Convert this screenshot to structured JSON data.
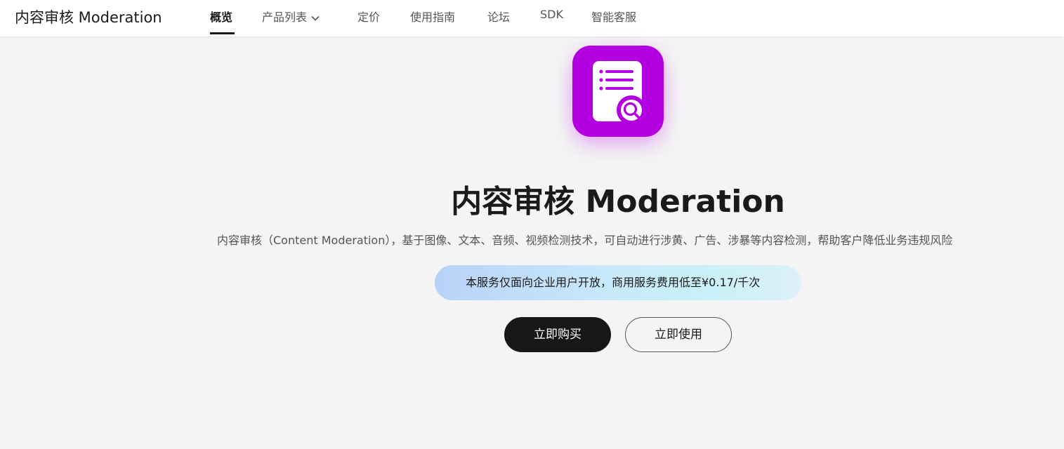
{
  "header": {
    "brand": "内容审核 Moderation",
    "nav": [
      {
        "label": "概览",
        "active": true
      },
      {
        "label": "产品列表",
        "has_dropdown": true
      },
      {
        "label": "定价"
      },
      {
        "label": "使用指南"
      },
      {
        "label": "论坛"
      },
      {
        "label": "SDK"
      },
      {
        "label": "智能客服"
      }
    ]
  },
  "hero": {
    "icon": "document-search-icon",
    "icon_color": "#b300e0",
    "title": "内容审核 Moderation",
    "description": "内容审核（Content Moderation），基于图像、文本、音频、视频检测技术，可自动进行涉黄、广告、涉暴等内容检测，帮助客户降低业务违规风险",
    "notice": "本服务仅面向企业用户开放，商用服务费用低至¥0.17/千次",
    "buy_button": "立即购买",
    "use_button": "立即使用"
  }
}
